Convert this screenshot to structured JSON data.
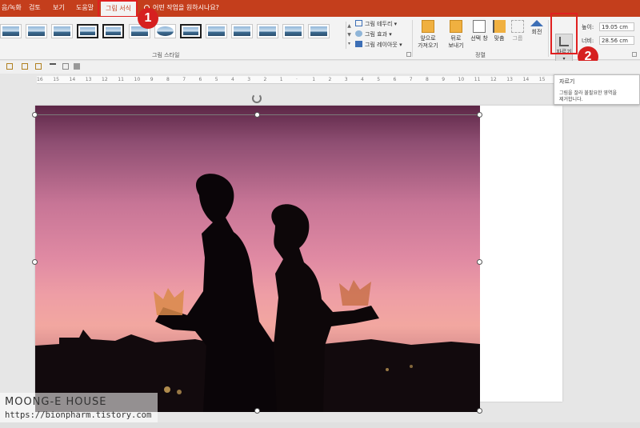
{
  "tabs": {
    "t1": "음/녹화",
    "t2": "검토",
    "t3": "보기",
    "t4": "도움말",
    "active": "그림 서식",
    "search": "어떤 작업을 원하시나요?"
  },
  "ribbon": {
    "picture_border": "그림 테두리",
    "picture_effects": "그림 효과",
    "picture_layout": "그림 레이아웃",
    "styles_group_label": "그림 스타일",
    "arrange_group_label": "정렬",
    "bring_forward_1": "앞으로",
    "bring_forward_2": "가져오기",
    "send_backward_1": "뒤로",
    "send_backward_2": "보내기",
    "selection_pane": "선택 창",
    "align": "맞춤",
    "group": "그룹",
    "rotate": "회전",
    "crop": "자르기",
    "height_label": "높이:",
    "height_value": "19.05 cm",
    "width_label": "너비:",
    "width_value": "28.56 cm"
  },
  "badges": {
    "b1": "1",
    "b2": "2"
  },
  "tooltip": {
    "title": "자르기",
    "desc_1": "그림을 잘라 불필요한 영역을",
    "desc_2": "제거합니다."
  },
  "ruler": {
    "ticks": [
      "16",
      "15",
      "14",
      "13",
      "12",
      "11",
      "10",
      "9",
      "8",
      "7",
      "6",
      "5",
      "4",
      "3",
      "2",
      "1",
      "",
      "1",
      "2",
      "3",
      "4",
      "5",
      "6",
      "7",
      "8",
      "9",
      "10",
      "11",
      "12",
      "13",
      "14",
      "15",
      "16"
    ]
  },
  "watermark": {
    "title": "MOONG-E HOUSE",
    "url": "https://bionpharm.tistory.com"
  },
  "colors": {
    "ribbon_accent": "#c43e1c",
    "highlight_red": "#e02020",
    "badge_red": "#d62020"
  }
}
